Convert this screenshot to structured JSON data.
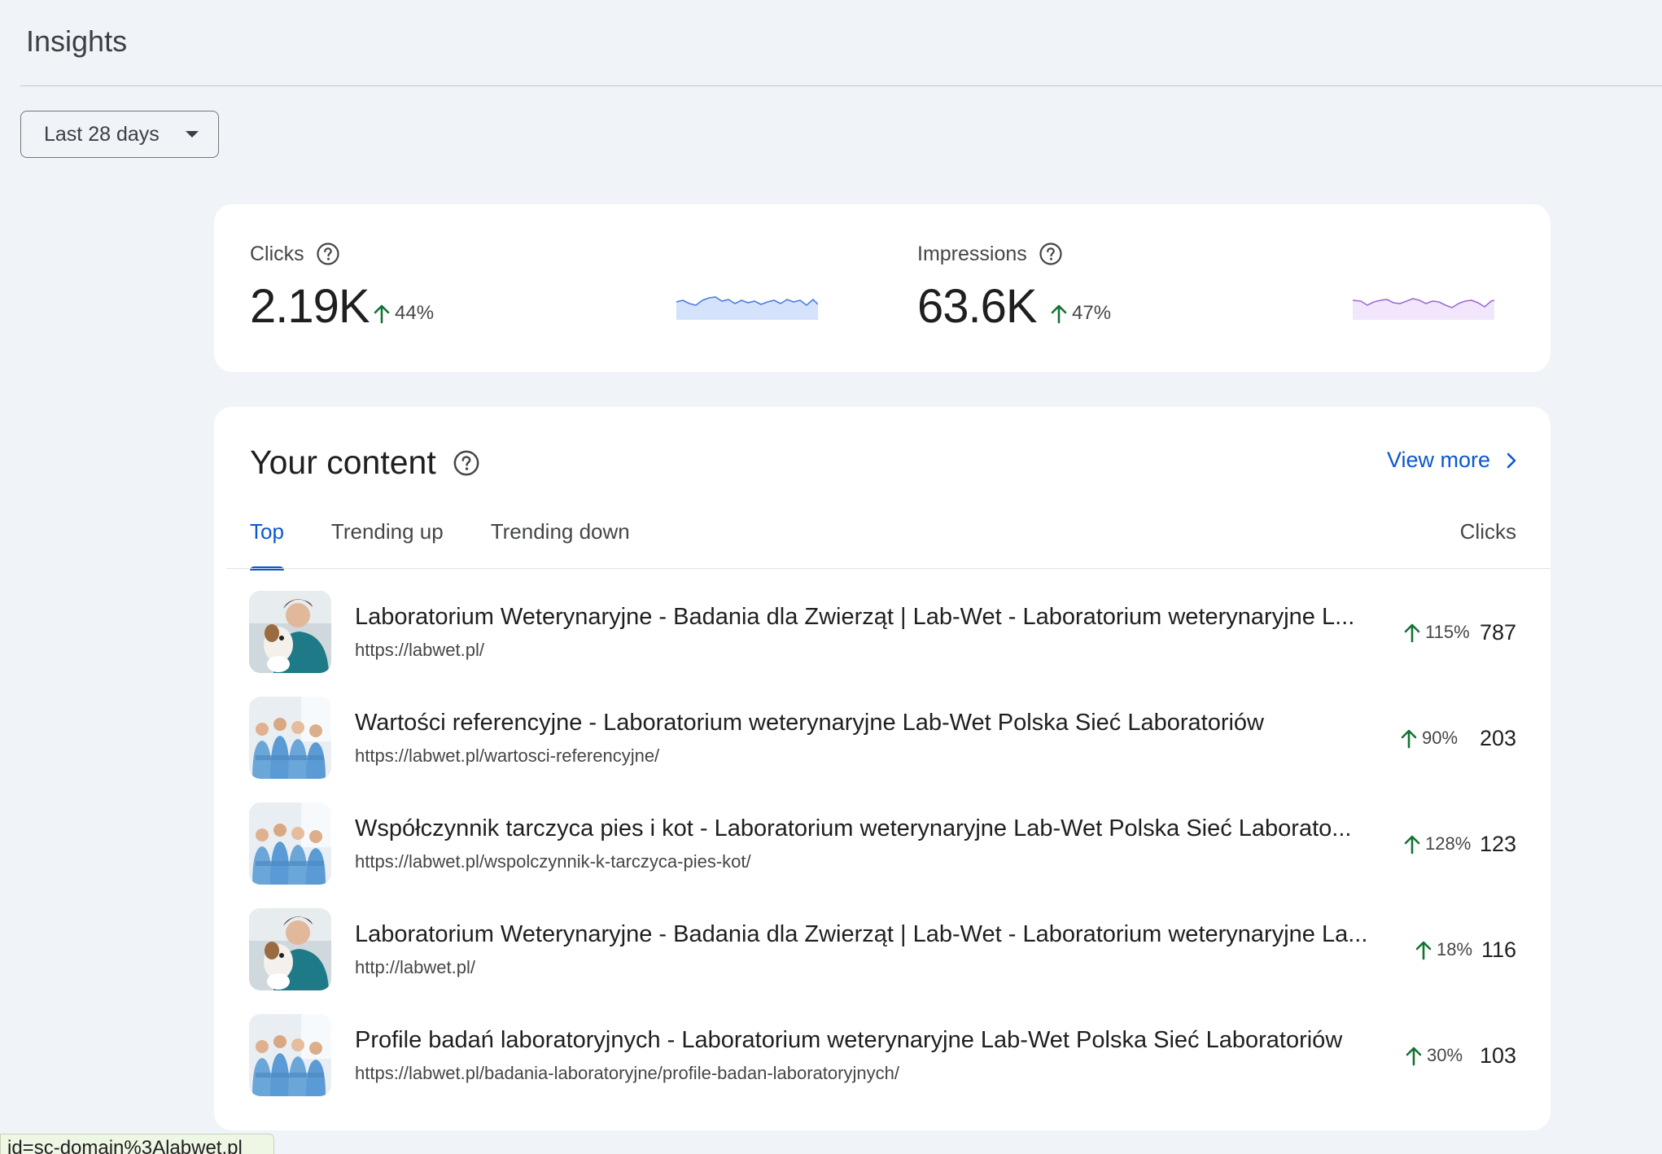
{
  "page": {
    "title": "Insights"
  },
  "date_range": {
    "selected": "Last 28 days"
  },
  "metrics": {
    "clicks": {
      "label": "Clicks",
      "value": "2.19K",
      "change": "44%",
      "direction": "up",
      "color": "#4c7de8"
    },
    "impressions": {
      "label": "Impressions",
      "value": "63.6K",
      "change": "47%",
      "direction": "up",
      "color": "#9d6cd3"
    }
  },
  "content": {
    "title": "Your content",
    "view_more": "View more",
    "tabs": [
      {
        "label": "Top",
        "active": true
      },
      {
        "label": "Trending up",
        "active": false
      },
      {
        "label": "Trending down",
        "active": false
      }
    ],
    "column_header": "Clicks",
    "rows": [
      {
        "title": "Laboratorium Weterynaryjne - Badania dla Zwierząt | Lab-Wet - Laboratorium weterynaryjne L...",
        "url": "https://labwet.pl/",
        "change": "115%",
        "clicks": "787",
        "thumb": "vet-with-dog"
      },
      {
        "title": "Wartości referencyjne - Laboratorium weterynaryjne Lab-Wet Polska Sieć Laboratoriów",
        "url": "https://labwet.pl/wartosci-referencyjne/",
        "change": "90%",
        "clicks": "203",
        "thumb": "vet-team"
      },
      {
        "title": "Współczynnik tarczyca pies i kot - Laboratorium weterynaryjne Lab-Wet Polska Sieć Laborato...",
        "url": "https://labwet.pl/wspolczynnik-k-tarczyca-pies-kot/",
        "change": "128%",
        "clicks": "123",
        "thumb": "vet-team"
      },
      {
        "title": "Laboratorium Weterynaryjne - Badania dla Zwierząt | Lab-Wet - Laboratorium weterynaryjne La...",
        "url": "http://labwet.pl/",
        "change": "18%",
        "clicks": "116",
        "thumb": "vet-with-dog"
      },
      {
        "title": "Profile badań laboratoryjnych - Laboratorium weterynaryjne Lab-Wet Polska Sieć Laboratoriów",
        "url": "https://labwet.pl/badania-laboratoryjne/profile-badan-laboratoryjnych/",
        "change": "30%",
        "clicks": "103",
        "thumb": "vet-team"
      }
    ]
  },
  "status_bar": {
    "text": "id=sc-domain%3Alabwet.pl"
  },
  "colors": {
    "accent": "#0b57d0",
    "positive": "#137333",
    "background": "#f0f4f9"
  }
}
